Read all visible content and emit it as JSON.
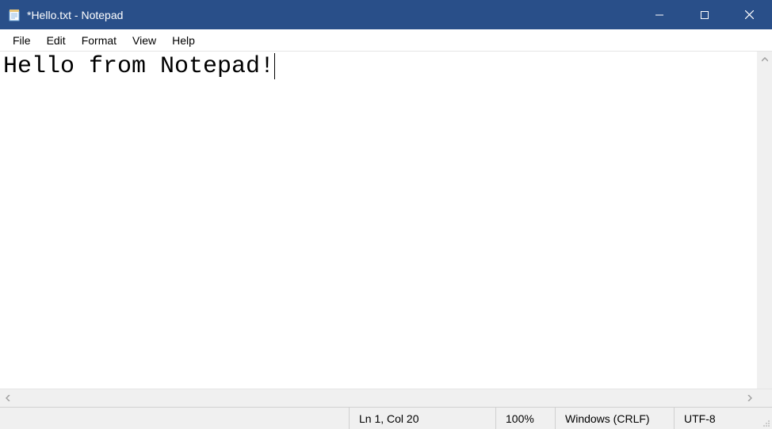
{
  "window": {
    "title": "*Hello.txt - Notepad"
  },
  "menubar": {
    "items": [
      "File",
      "Edit",
      "Format",
      "View",
      "Help"
    ]
  },
  "editor": {
    "content": "Hello from Notepad!"
  },
  "statusbar": {
    "position": "Ln 1, Col 20",
    "zoom": "100%",
    "line_endings": "Windows (CRLF)",
    "encoding": "UTF-8"
  }
}
